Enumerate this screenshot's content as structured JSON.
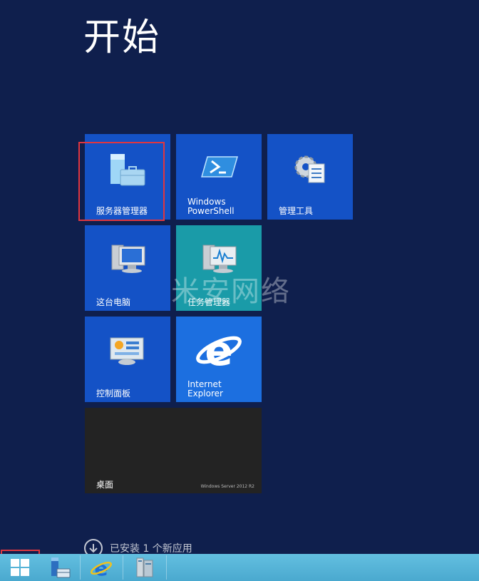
{
  "start": {
    "title": "开始"
  },
  "tiles": [
    {
      "label": "服务器管理器",
      "icon": "server-manager-icon"
    },
    {
      "label": "Windows\nPowerShell",
      "icon": "powershell-icon"
    },
    {
      "label": "管理工具",
      "icon": "admin-tools-icon"
    },
    {
      "label": "这台电脑",
      "icon": "computer-icon"
    },
    {
      "label": "任务管理器",
      "icon": "task-manager-icon"
    },
    {
      "label": "控制面板",
      "icon": "control-panel-icon"
    },
    {
      "label": "Internet\nExplorer",
      "icon": "internet-explorer-icon"
    },
    {
      "label": "桌面",
      "brand": "Windows Server 2012 R2"
    }
  ],
  "watermark": "米安网络",
  "notification": {
    "text": "已安装 1 个新应用"
  },
  "taskbar": {
    "items": [
      "start-button",
      "server-manager",
      "internet-explorer",
      "file-explorer"
    ]
  },
  "colors": {
    "background": "#0f1f4d",
    "tile_blue": "#1452c6",
    "tile_teal": "#1a9ba8",
    "highlight": "#e0363f",
    "taskbar": "#5ab6dc"
  }
}
